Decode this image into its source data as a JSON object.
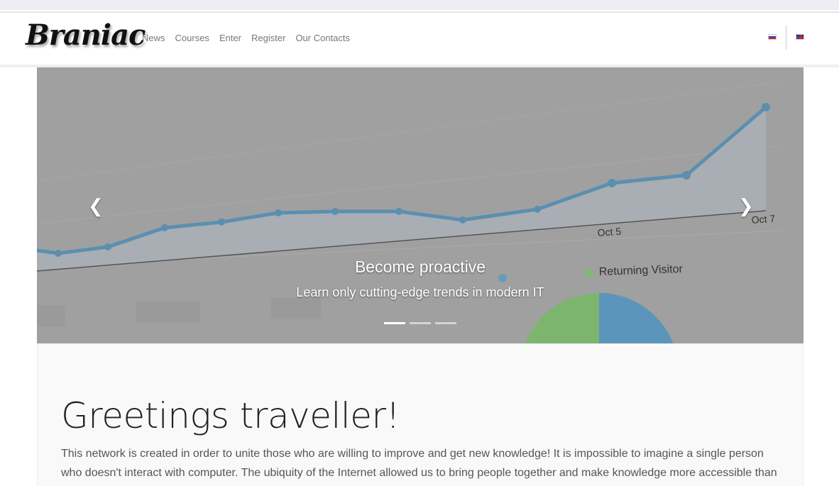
{
  "navbar": {
    "brand": "Braniac",
    "links": [
      "News",
      "Courses",
      "Enter",
      "Register",
      "Our Contacts"
    ],
    "languages": [
      "ru-flag-icon",
      "en-flag-icon"
    ]
  },
  "carousel": {
    "caption_title": "Become proactive",
    "caption_text": "Learn only cutting-edge trends in modern IT",
    "prev_icon": "chevron-left-icon",
    "next_icon": "chevron-right-icon",
    "indicator_count": 3,
    "active_index": 0,
    "background_labels": {
      "tick_1": "Oct 5",
      "tick_2": "Oct 7",
      "legend": "Returning Visitor"
    }
  },
  "jumbotron": {
    "title": "Greetings traveller!",
    "text": "This network is created in order to unite those who are willing to improve and get new knowledge! It is impossible to imagine a single person who doesn't interact with computer. The ubiquity of the Internet allowed us to bring people together and make knowledge more accessible than"
  },
  "colors": {
    "overlay": "#9e9e9e",
    "chart_line": "#5b8fb0",
    "jumbotron_bg": "#f9f9f9"
  }
}
